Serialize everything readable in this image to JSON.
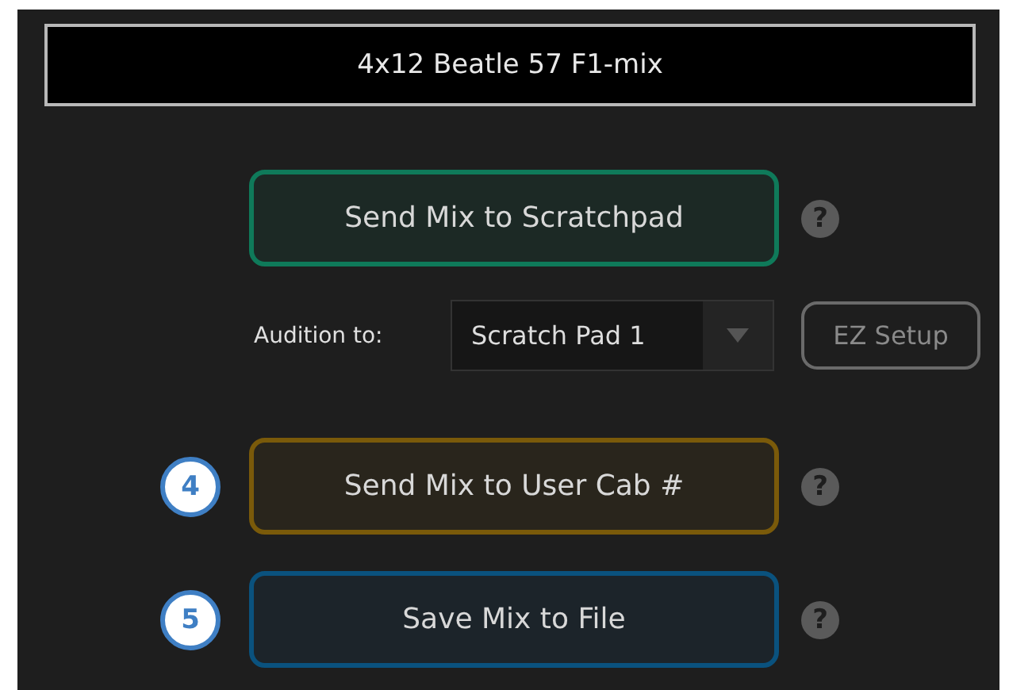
{
  "name_field": {
    "value": "4x12 Beatle 57 F1-mix"
  },
  "actions": [
    {
      "kind": "button",
      "label": "Send Mix to Scratchpad",
      "color": "#0f7a5a",
      "help": "?"
    },
    {
      "kind": "audition",
      "label": "Audition to:",
      "dropdown": {
        "value": "Scratch Pad 1"
      },
      "ez_setup": {
        "label": "EZ Setup",
        "disabled": true
      }
    },
    {
      "kind": "button",
      "label": "Send Mix to User Cab #",
      "color": "#7a5a0a",
      "badge": "4",
      "help": "?"
    },
    {
      "kind": "button",
      "label": "Save Mix to File",
      "color": "#0a527e",
      "badge": "5",
      "help": "?"
    }
  ]
}
